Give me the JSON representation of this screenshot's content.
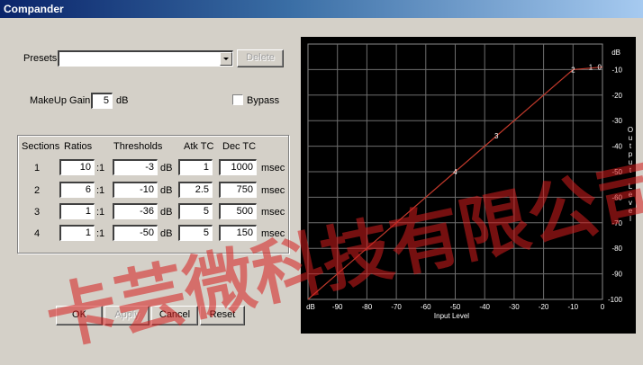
{
  "window": {
    "title": "Compander"
  },
  "presets": {
    "label": "Presets",
    "value": "",
    "delete_label": "Delete"
  },
  "makeup": {
    "label": "MakeUp Gain",
    "value": "5",
    "unit": "dB"
  },
  "bypass": {
    "label": "Bypass",
    "checked": false
  },
  "table": {
    "headers": {
      "sections": "Sections",
      "ratios": "Ratios",
      "thresholds": "Thresholds",
      "atk": "Atk TC",
      "dec": "Dec TC"
    },
    "ratio_suffix": ":1",
    "threshold_unit": "dB",
    "time_unit": "msec",
    "rows": [
      {
        "section": "1",
        "ratio": "10",
        "threshold": "-3",
        "atk": "1",
        "dec": "1000"
      },
      {
        "section": "2",
        "ratio": "6",
        "threshold": "-10",
        "atk": "2.5",
        "dec": "750"
      },
      {
        "section": "3",
        "ratio": "1",
        "threshold": "-36",
        "atk": "5",
        "dec": "500"
      },
      {
        "section": "4",
        "ratio": "1",
        "threshold": "-50",
        "atk": "5",
        "dec": "150"
      }
    ]
  },
  "buttons": {
    "ok": "OK",
    "apply": "Apply",
    "cancel": "Cancel",
    "reset": "Reset"
  },
  "chart_data": {
    "type": "line",
    "xlabel": "Input Level",
    "ylabel": "Output Level",
    "x_unit": "dB",
    "y_unit": "dB",
    "xlim": [
      -100,
      0
    ],
    "ylim": [
      -100,
      0
    ],
    "x_ticks": [
      "-90",
      "-80",
      "-70",
      "-60",
      "-50",
      "-40",
      "-30",
      "-20",
      "-10",
      "0"
    ],
    "y_ticks": [
      "-10",
      "-20",
      "-30",
      "-40",
      "-50",
      "-60",
      "-70",
      "-80",
      "-90",
      "-100"
    ],
    "line_color": "#c0392b",
    "grid": true,
    "curve": [
      {
        "x": -100,
        "y": -100
      },
      {
        "x": -50,
        "y": -50
      },
      {
        "x": -36,
        "y": -36
      },
      {
        "x": -10,
        "y": -10
      },
      {
        "x": -3,
        "y": -9.3
      },
      {
        "x": 0,
        "y": -9
      }
    ],
    "markers": [
      {
        "label": "4",
        "x": -50,
        "y": -50
      },
      {
        "label": "3",
        "x": -36,
        "y": -36
      },
      {
        "label": "2",
        "x": -10,
        "y": -10
      },
      {
        "label": "1",
        "x": -4,
        "y": -9
      },
      {
        "label": "0",
        "x": -1,
        "y": -9
      }
    ]
  },
  "watermark": {
    "text": "卡芸微科技有限公司"
  }
}
